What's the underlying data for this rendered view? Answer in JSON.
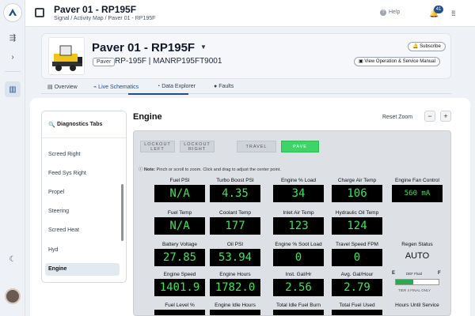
{
  "header": {
    "title": "Paver 01 - RP195F",
    "breadcrumb": "Signal / Activity Map / Paver 01 - RP195F",
    "help_label": "Help",
    "notification_count": "41"
  },
  "asset": {
    "name": "Paver 01 - RP195F",
    "type_chip": "Paver",
    "model_serial": "RP-195F | MANRP195FT9001",
    "subscribe_label": "Subscribe",
    "manual_label": "View Operation & Service Manual"
  },
  "tabs": [
    {
      "label": "Overview",
      "icon": "document-icon"
    },
    {
      "label": "Live Schematics",
      "icon": "activity-icon",
      "active": true
    },
    {
      "label": "Data Explorer",
      "icon": "chart-icon"
    },
    {
      "label": "Faults",
      "icon": "alert-icon"
    }
  ],
  "diagnostics": {
    "title": "Diagnostics Tabs",
    "items": [
      "Screed Right",
      "Feed Sys Right",
      "Propel",
      "Steering",
      "Screed Heat",
      "Hyd",
      "Engine"
    ],
    "active": "Engine"
  },
  "engine": {
    "title": "Engine",
    "reset_zoom": "Reset Zoom",
    "zoom_out": "−",
    "zoom_in": "+"
  },
  "controls": {
    "lockout_left": "LOCKOUT LEFT",
    "lockout_right": "LOCKOUT RIGHT",
    "travel": "TRAVEL",
    "pave": "PAVE"
  },
  "note": {
    "prefix": "Note:",
    "text": "Pinch or scroll to zoom. Click and drag to adjust the center point."
  },
  "gauges": {
    "fuel_psi": {
      "label": "Fuel PSI",
      "value": "N/A"
    },
    "turbo_boost_psi": {
      "label": "Turbo Boost PSI",
      "value": "4.35"
    },
    "engine_load": {
      "label": "Engine % Load",
      "value": "34"
    },
    "charge_air_temp": {
      "label": "Charge Air Temp",
      "value": "106"
    },
    "engine_fan_control": {
      "label": "Engine Fan Control",
      "value": "560 mA"
    },
    "fuel_temp": {
      "label": "Fuel Temp",
      "value": "N/A"
    },
    "coolant_temp": {
      "label": "Coolant Temp",
      "value": "177"
    },
    "inlet_air_temp": {
      "label": "Inlet Air Temp",
      "value": "123"
    },
    "hydraulic_oil_temp": {
      "label": "Hydraulic Oil Temp",
      "value": "124"
    },
    "battery_voltage": {
      "label": "Battery Voltage",
      "value": "27.85"
    },
    "oil_psi": {
      "label": "Oil PSI",
      "value": "53.94"
    },
    "soot_load": {
      "label": "Engine % Soot Load",
      "value": "0"
    },
    "travel_speed": {
      "label": "Travel Speed FPM",
      "value": "0"
    },
    "engine_speed": {
      "label": "Engine Speed",
      "value": "1401.9"
    },
    "engine_hours": {
      "label": "Engine Hours",
      "value": "1782.0"
    },
    "inst_gal_hr": {
      "label": "Inst. Gal/Hr",
      "value": "2.56"
    },
    "avg_gal_hour": {
      "label": "Avg. Gal/Hour",
      "value": "2.79"
    }
  },
  "regen": {
    "label": "Regen Status",
    "value": "AUTO"
  },
  "def": {
    "empty": "E",
    "full": "F",
    "label": "DEF Fluid",
    "level_fraction": 0.4,
    "tier": "TIER 4 FINAL ONLY"
  },
  "bottom_labels": [
    "Fuel Level %",
    "Engine Idle Hours",
    "Total Idle Fuel Burn",
    "Total Fuel Used",
    "Hours Until Service"
  ],
  "colors": {
    "accent": "#1e4f8c",
    "gauge_bg": "#000000",
    "gauge_text": "#3de35c",
    "pave_green": "#3ed468"
  }
}
